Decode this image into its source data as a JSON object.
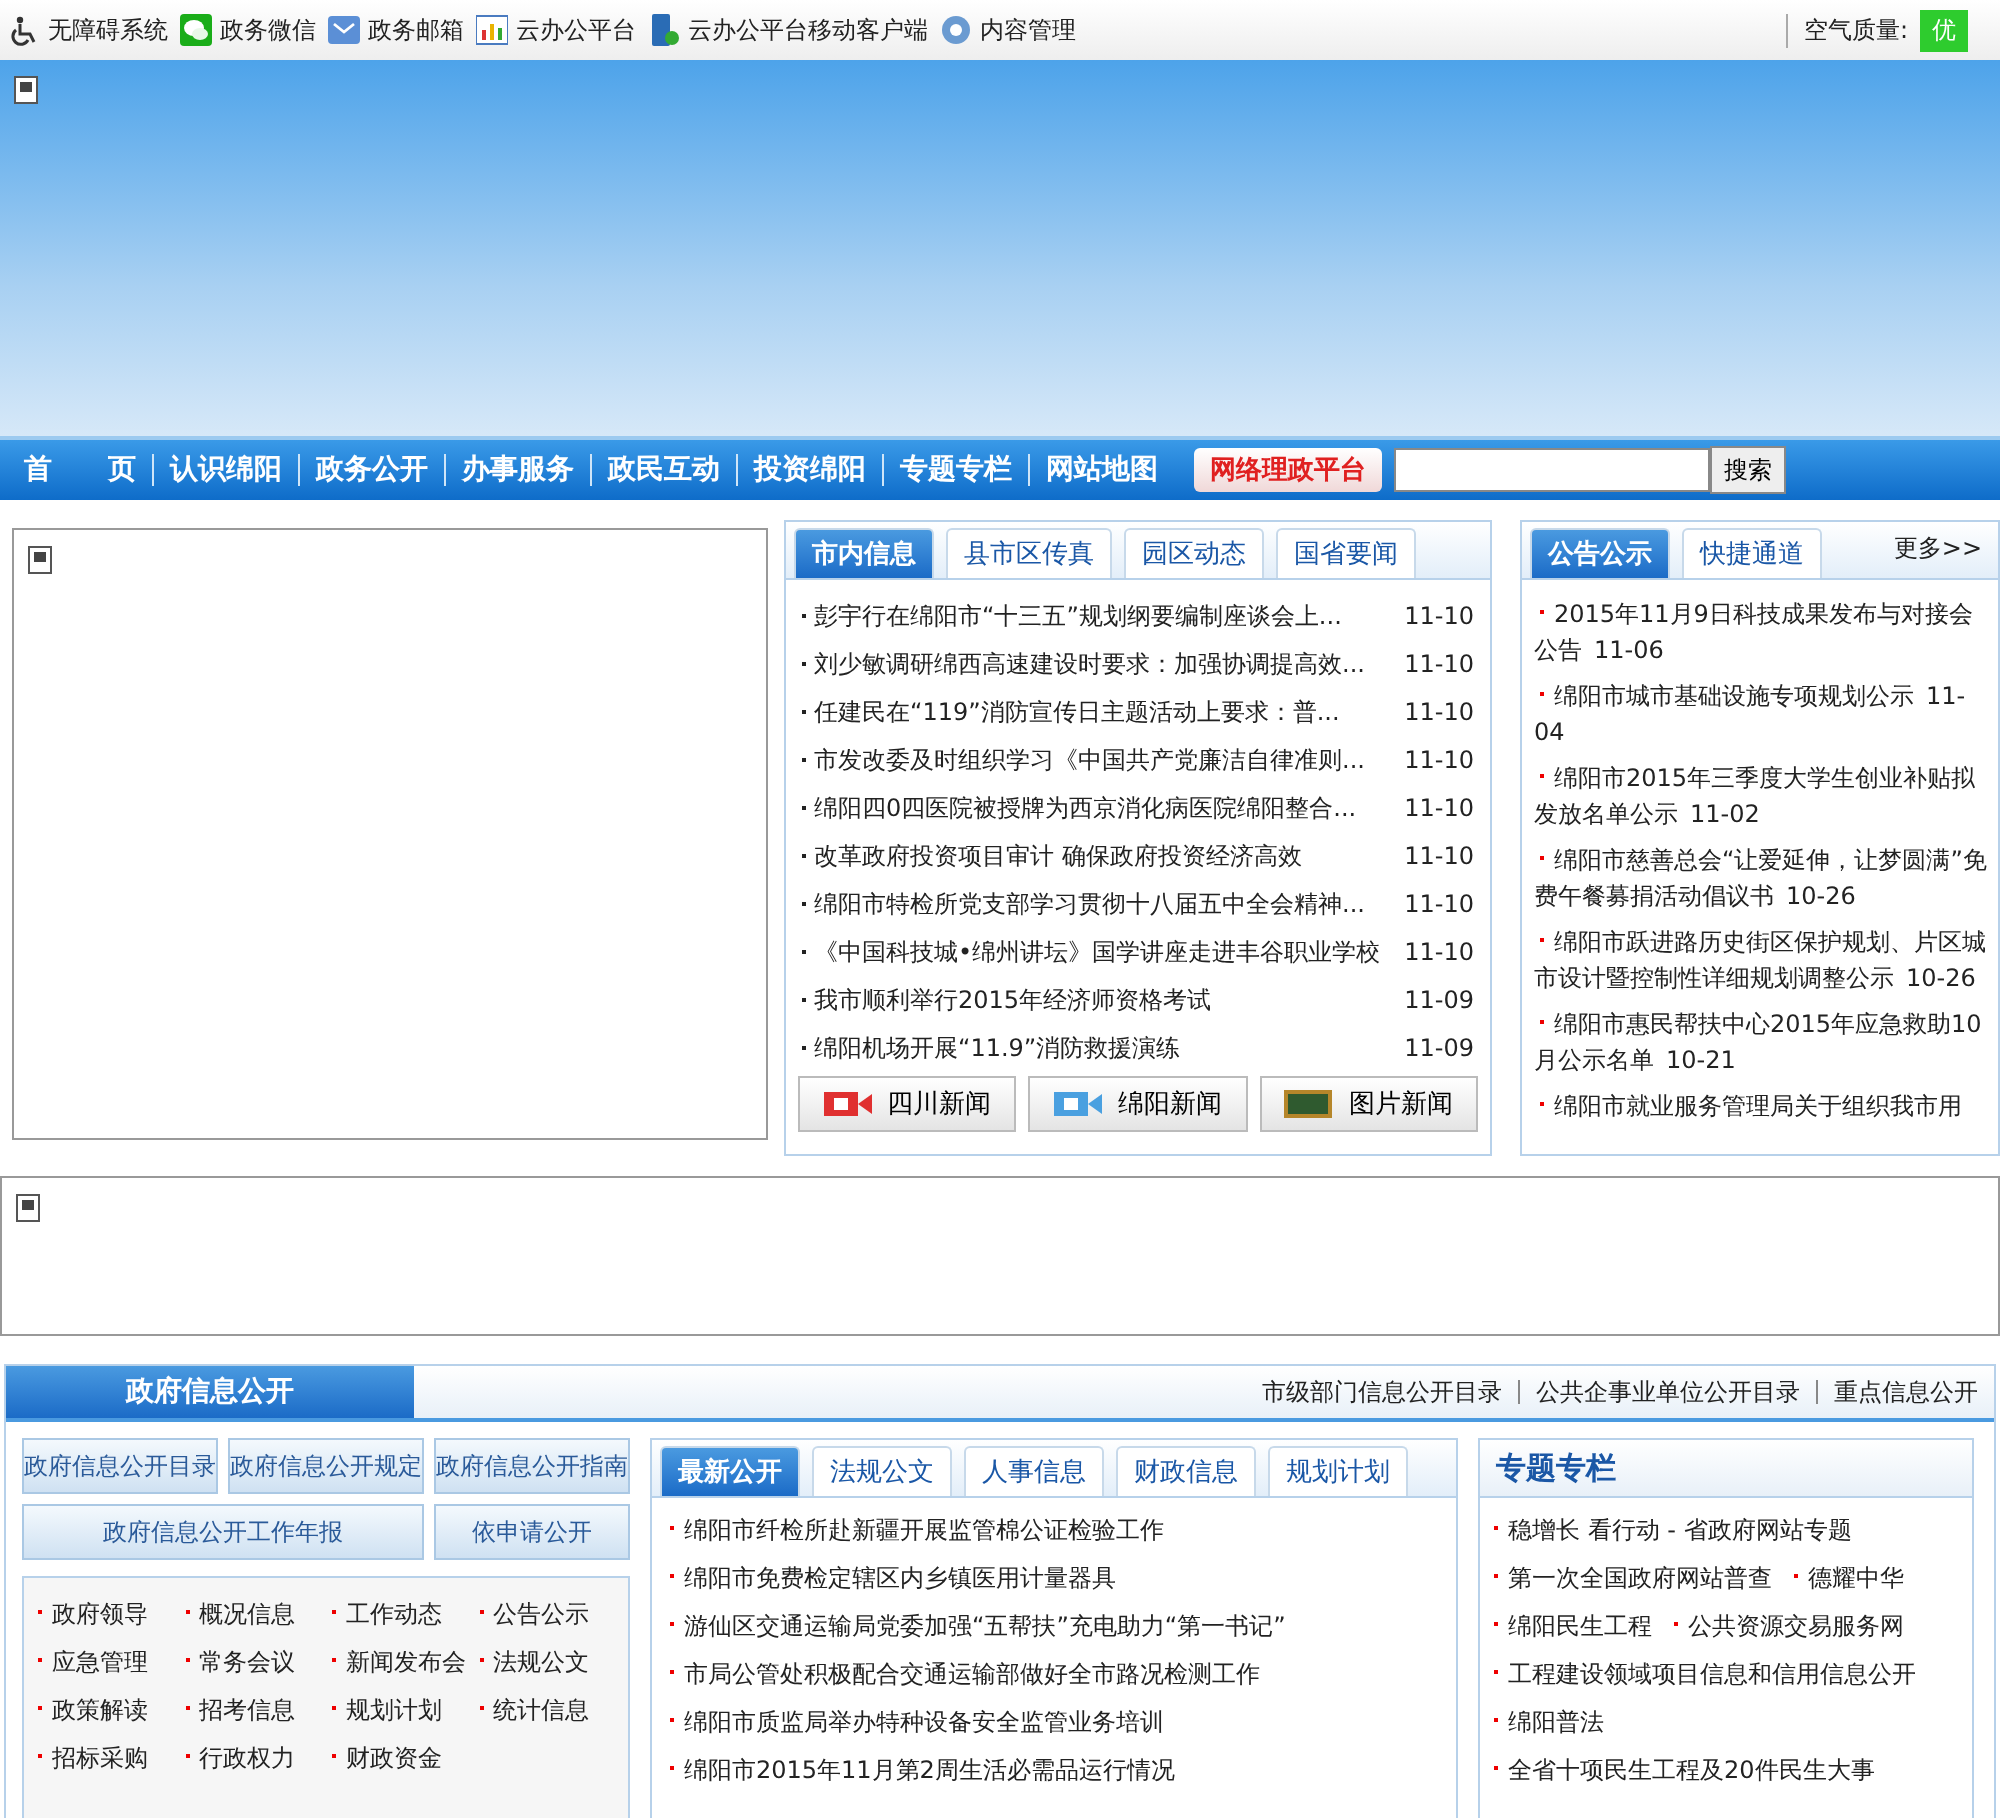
{
  "top_bar": {
    "links": [
      {
        "label": "无障碍系统"
      },
      {
        "label": "政务微信"
      },
      {
        "label": "政务邮箱"
      },
      {
        "label": "云办公平台"
      },
      {
        "label": "云办公平台移动客户端"
      },
      {
        "label": "内容管理"
      }
    ],
    "air_quality_label": "空气质量:",
    "air_quality_value": "优"
  },
  "nav": {
    "items": [
      "首　　页",
      "认识绵阳",
      "政务公开",
      "办事服务",
      "政民互动",
      "投资绵阳",
      "专题专栏",
      "网站地图"
    ],
    "highlight": "网络理政平台",
    "search_button": "搜索"
  },
  "news": {
    "tabs": [
      {
        "label": "市内信息",
        "selected": true
      },
      {
        "label": "县市区传真",
        "selected": false
      },
      {
        "label": "园区动态",
        "selected": false
      },
      {
        "label": "国省要闻",
        "selected": false
      }
    ],
    "items": [
      {
        "title": "彭宇行在绵阳市“十三五”规划纲要编制座谈会上...",
        "date": "11-10"
      },
      {
        "title": "刘少敏调研绵西高速建设时要求：加强协调提高效...",
        "date": "11-10"
      },
      {
        "title": "任建民在“119”消防宣传日主题活动上要求：普...",
        "date": "11-10"
      },
      {
        "title": "市发改委及时组织学习《中国共产党廉洁自律准则...",
        "date": "11-10"
      },
      {
        "title": "绵阳四0四医院被授牌为西京消化病医院绵阳整合...",
        "date": "11-10"
      },
      {
        "title": "改革政府投资项目审计  确保政府投资经济高效",
        "date": "11-10"
      },
      {
        "title": "绵阳市特检所党支部学习贯彻十八届五中全会精神...",
        "date": "11-10"
      },
      {
        "title": "《中国科技城•绵州讲坛》国学讲座走进丰谷职业学校",
        "date": "11-10"
      },
      {
        "title": "我市顺利举行2015年经济师资格考试",
        "date": "11-09"
      },
      {
        "title": "绵阳机场开展“11.9”消防救援演练",
        "date": "11-09"
      }
    ],
    "buttons": [
      {
        "label": "四川新闻"
      },
      {
        "label": "绵阳新闻"
      },
      {
        "label": "图片新闻"
      }
    ]
  },
  "notices": {
    "tabs": [
      {
        "label": "公告公示",
        "selected": true
      },
      {
        "label": "快捷通道",
        "selected": false
      }
    ],
    "more": "更多>>",
    "items": [
      {
        "title": "2015年11月9日科技成果发布与对接会公告",
        "date": "11-06"
      },
      {
        "title": "绵阳市城市基础设施专项规划公示",
        "date": "11-04"
      },
      {
        "title": "绵阳市2015年三季度大学生创业补贴拟发放名单公示",
        "date": "11-02"
      },
      {
        "title": "绵阳市慈善总会“让爱延伸，让梦圆满”免费午餐募捐活动倡议书",
        "date": "10-26"
      },
      {
        "title": "绵阳市跃进路历史街区保护规划、片区城市设计暨控制性详细规划调整公示",
        "date": "10-26"
      },
      {
        "title": "绵阳市惠民帮扶中心2015年应急救助10月公示名单",
        "date": "10-21"
      },
      {
        "title": "绵阳市就业服务管理局关于组织我市用"
      }
    ]
  },
  "open_info": {
    "title": "政府信息公开",
    "links": [
      "市级部门信息公开目录",
      "公共企事业单位公开目录",
      "重点信息公开"
    ],
    "buttons": [
      "政府信息公开目录",
      "政府信息公开规定",
      "政府信息公开指南",
      "政府信息公开工作年报",
      "依申请公开"
    ],
    "categories": [
      "政府领导",
      "概况信息",
      "工作动态",
      "公告公示",
      "应急管理",
      "常务会议",
      "新闻发布会",
      "法规公文",
      "政策解读",
      "招考信息",
      "规划计划",
      "统计信息",
      "招标采购",
      "行政权力",
      "财政资金"
    ],
    "tabs": [
      {
        "label": "最新公开",
        "selected": true
      },
      {
        "label": "法规公文",
        "selected": false
      },
      {
        "label": "人事信息",
        "selected": false
      },
      {
        "label": "财政信息",
        "selected": false
      },
      {
        "label": "规划计划",
        "selected": false
      }
    ],
    "items": [
      "绵阳市纤检所赴新疆开展监管棉公证检验工作",
      "绵阳市免费检定辖区内乡镇医用计量器具",
      "游仙区交通运输局党委加强“五帮扶”充电助力“第一书记”",
      "市局公管处积极配合交通运输部做好全市路况检测工作",
      "绵阳市质监局举办特种设备安全监管业务培训",
      "绵阳市2015年11月第2周生活必需品运行情况"
    ]
  },
  "topics": {
    "title": "专题专栏",
    "rows": [
      [
        "稳增长 看行动 - 省政府网站专题"
      ],
      [
        "第一次全国政府网站普查",
        "德耀中华"
      ],
      [
        "绵阳民生工程",
        "公共资源交易服务网"
      ],
      [
        "工程建设领域项目信息和信用信息公开"
      ],
      [
        "绵阳普法"
      ],
      [
        "全省十项民生工程及20件民生大事"
      ]
    ]
  }
}
